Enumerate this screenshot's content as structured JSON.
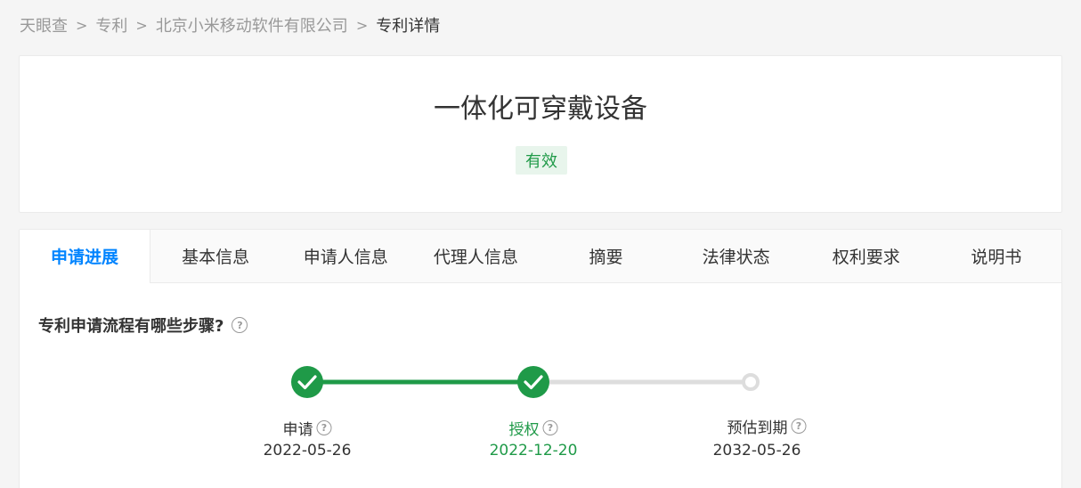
{
  "breadcrumb": {
    "items": [
      "天眼查",
      "专利",
      "北京小米移动软件有限公司"
    ],
    "current": "专利详情"
  },
  "patent": {
    "title": "一体化可穿戴设备",
    "status": "有效"
  },
  "tabs": [
    "申请进展",
    "基本信息",
    "申请人信息",
    "代理人信息",
    "摘要",
    "法律状态",
    "权利要求",
    "说明书"
  ],
  "active_tab": "申请进展",
  "progress": {
    "title": "专利申请流程有哪些步骤?",
    "steps": [
      {
        "label": "申请",
        "date": "2022-05-26",
        "completed": true
      },
      {
        "label": "授权",
        "date": "2022-12-20",
        "completed": true
      },
      {
        "label": "预估到期",
        "date": "2032-05-26",
        "completed": false
      }
    ]
  },
  "colors": {
    "accent_blue": "#0084ff",
    "success_green": "#1f9a48",
    "inactive_gray": "#dddddd"
  }
}
